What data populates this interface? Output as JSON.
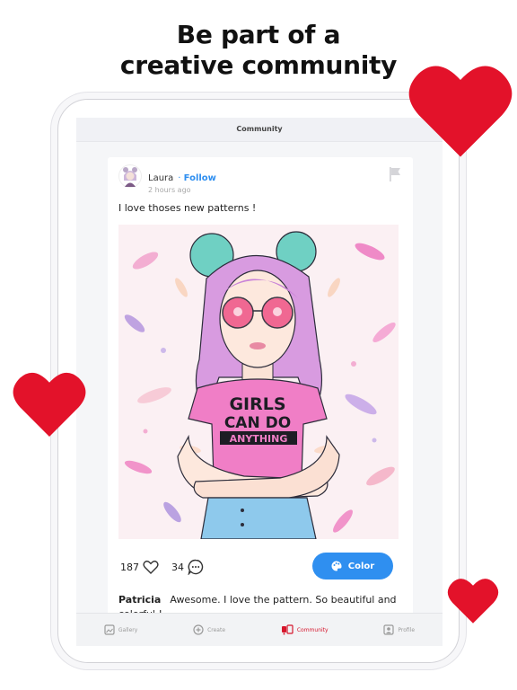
{
  "headline": {
    "line1": "Be part of a",
    "line2": "creative community"
  },
  "header": {
    "title": "Community"
  },
  "post": {
    "author": "Laura",
    "follow_dot": "·",
    "follow_label": "Follow",
    "time": "2 hours ago",
    "caption": "I love thoses new patterns !",
    "artwork": {
      "shirt_line1": "GIRLS",
      "shirt_line2": "CAN DO",
      "shirt_line3": "ANYTHING"
    },
    "likes": "187",
    "comments": "34",
    "color_button": "Color",
    "comment": {
      "author": "Patricia",
      "text": "Awesome. I love the pattern. So beautiful and colorful !"
    }
  },
  "tabbar": {
    "tabs": [
      {
        "label": "Gallery",
        "icon": "gallery-icon"
      },
      {
        "label": "Create",
        "icon": "create-icon"
      },
      {
        "label": "Community",
        "icon": "community-icon",
        "active": true
      },
      {
        "label": "Profile",
        "icon": "profile-icon"
      }
    ]
  },
  "colors": {
    "accent_blue": "#2f8ff0",
    "heart_red": "#e3122a",
    "active_tab": "#d6162c"
  }
}
